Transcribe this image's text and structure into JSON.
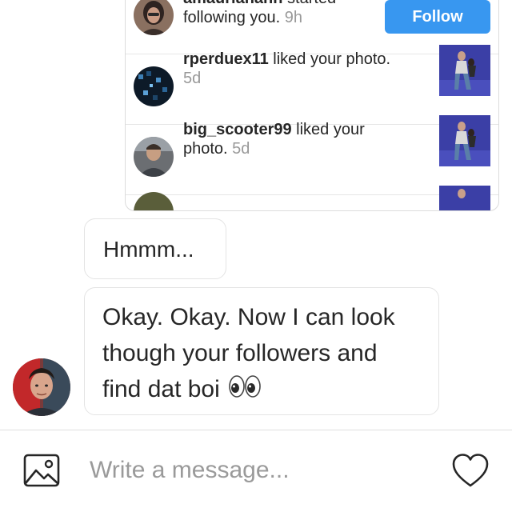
{
  "activity": [
    {
      "username": "amaurianahh",
      "action": " started following you.",
      "time": "9h",
      "button": "Follow",
      "avatar": "user-avatar"
    },
    {
      "username": "rperduex11",
      "action": " liked your photo.",
      "time": "5d",
      "avatar": "user-avatar",
      "thumbnail": "photo-thumbnail"
    },
    {
      "username": "big_scooter99",
      "action": " liked your photo.",
      "time": "5d",
      "avatar": "user-avatar",
      "thumbnail": "photo-thumbnail"
    }
  ],
  "messages": [
    {
      "text": "Hmmm..."
    },
    {
      "text": "Okay. Okay. Now I can look though your followers and find dat boi",
      "emoji": "eyes-emoji"
    }
  ],
  "composer": {
    "placeholder": "Write a message...",
    "gallery_icon": "image-icon",
    "like_icon": "heart-icon"
  },
  "colors": {
    "follow_button": "#3897f0",
    "timestamp": "#999999",
    "bubble_border": "#e3e3e3"
  }
}
